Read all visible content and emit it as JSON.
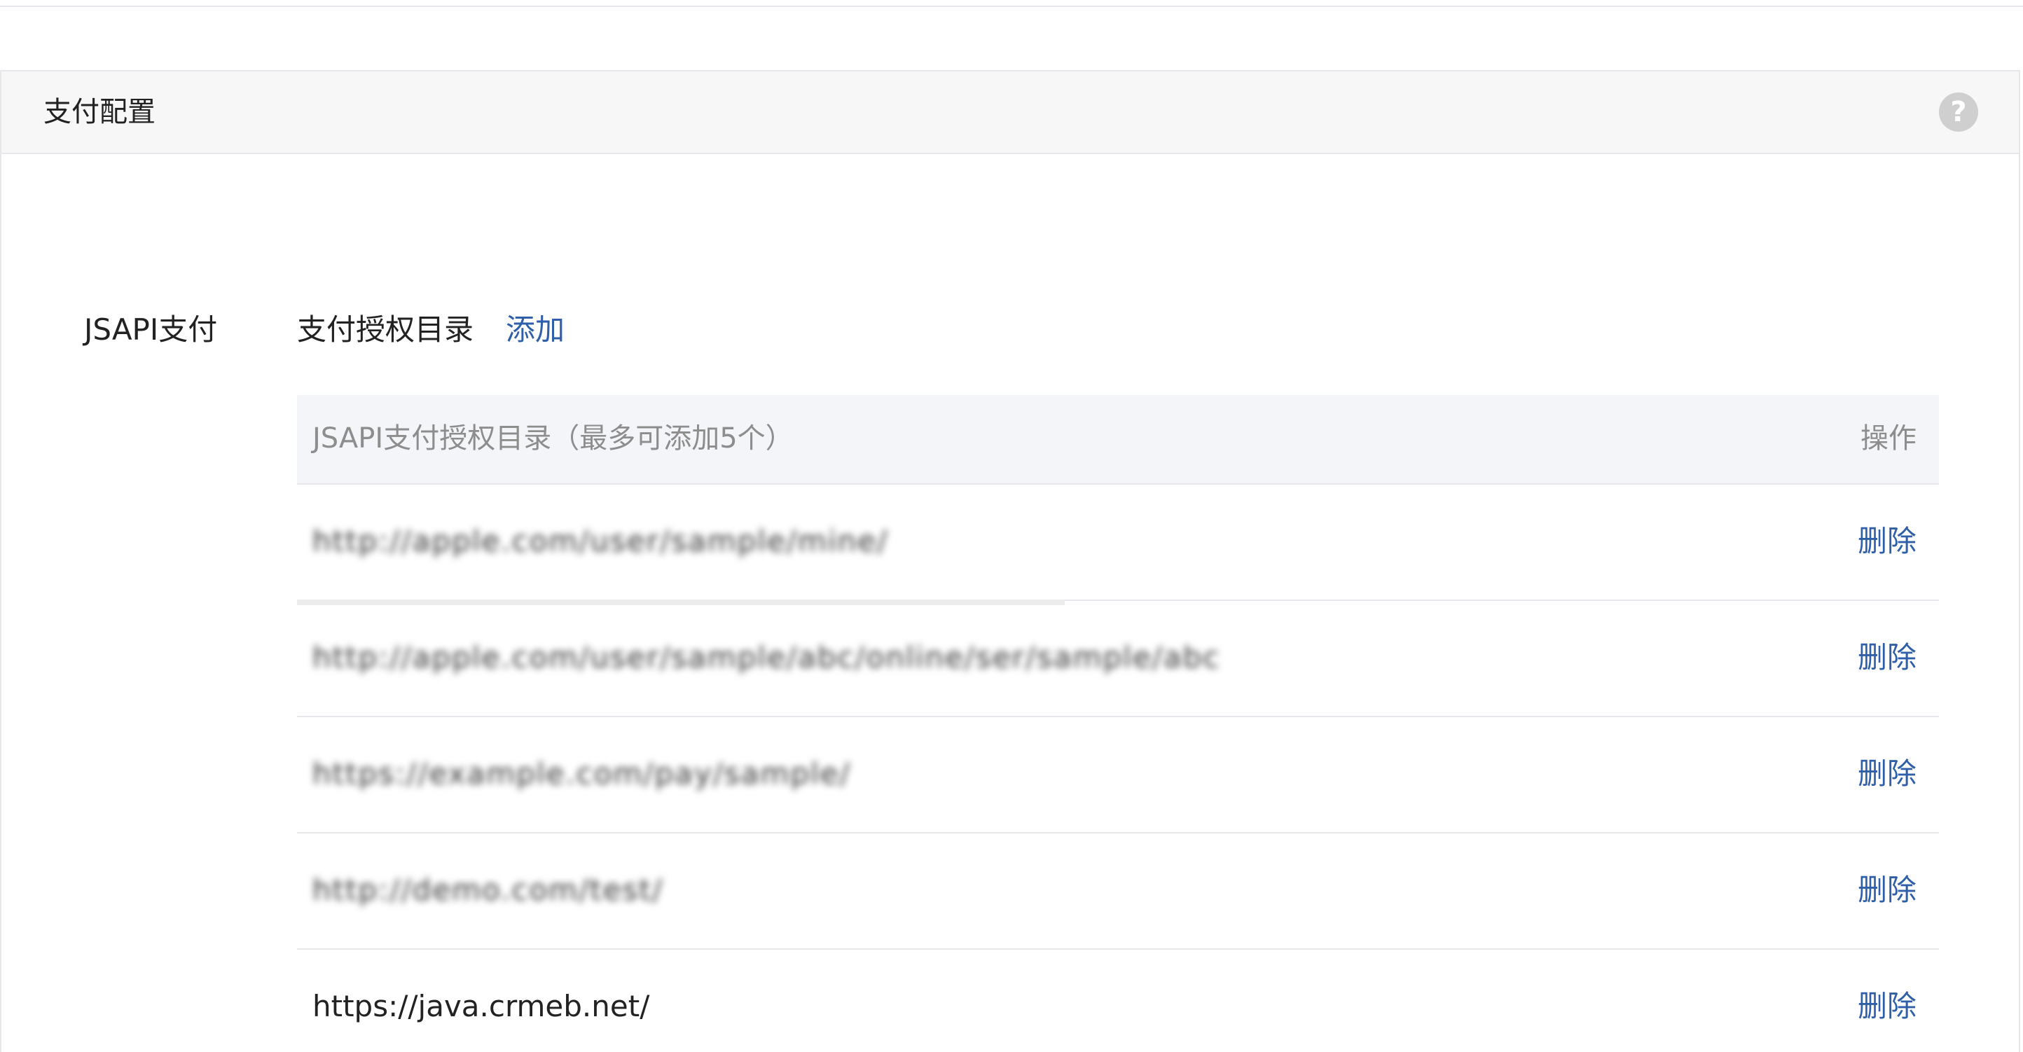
{
  "panel": {
    "title": "支付配置",
    "help_icon": "question-circle-icon",
    "help_symbol": "?"
  },
  "jsapi": {
    "section_label": "JSAPI支付",
    "directory_label": "支付授权目录",
    "add_label": "添加"
  },
  "table": {
    "header": {
      "title": "JSAPI支付授权目录（最多可添加5个）",
      "action": "操作"
    },
    "rows": [
      {
        "value": "http://apple.com/user/sample/mine/",
        "blurred": true,
        "action": "删除"
      },
      {
        "value": "http://apple.com/user/sample/abc/online/ser/sample/abc",
        "blurred": true,
        "action": "删除"
      },
      {
        "value": "https://example.com/pay/sample/",
        "blurred": true,
        "action": "删除"
      },
      {
        "value": "http://demo.com/test/",
        "blurred": true,
        "action": "删除"
      },
      {
        "value": "https://java.crmeb.net/",
        "blurred": false,
        "action": "删除"
      }
    ]
  },
  "colors": {
    "link": "#2f5fa8",
    "header_bg": "#f7f7f7",
    "table_head_bg": "#f4f5f9",
    "border": "#e7e7eb"
  }
}
